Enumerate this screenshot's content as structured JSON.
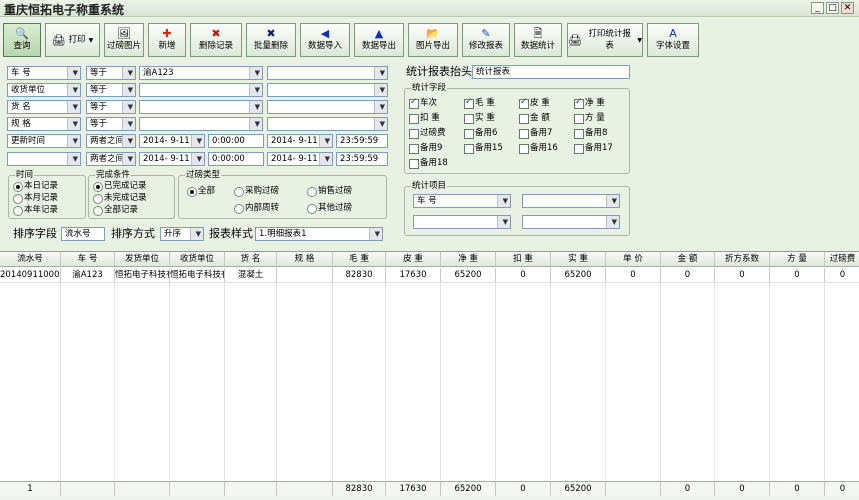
{
  "window": {
    "title": "重庆恒拓电子称重系统",
    "min": "_",
    "max": "□",
    "close": "✕"
  },
  "toolbar": [
    {
      "name": "query-button",
      "label": "查询",
      "icon": "🔍",
      "row": false,
      "sel": true
    },
    {
      "name": "print-button",
      "label": "打印",
      "icon": "🖨",
      "row": true,
      "drop": "▼"
    },
    {
      "name": "weigh-image-button",
      "label": "过磅图片",
      "icon": "🖼"
    },
    {
      "name": "add-button",
      "label": "新增",
      "icon": "✚",
      "color": "#d21"
    },
    {
      "name": "delete-record-button",
      "label": "删除记录",
      "icon": "✖",
      "color": "#c11"
    },
    {
      "name": "batch-delete-button",
      "label": "批量删除",
      "icon": "✖",
      "color": "#126"
    },
    {
      "name": "data-import-button",
      "label": "数据导入",
      "icon": "◀",
      "color": "#13a"
    },
    {
      "name": "data-export-button",
      "label": "数据导出",
      "icon": "▲",
      "color": "#13a"
    },
    {
      "name": "image-export-button",
      "label": "图片导出",
      "icon": "📂"
    },
    {
      "name": "edit-report-button",
      "label": "修改报表",
      "icon": "✎",
      "color": "#24a"
    },
    {
      "name": "data-stats-button",
      "label": "数据统计",
      "icon": "🗎"
    },
    {
      "name": "print-stats-report-button",
      "label": "打印统计报表",
      "icon": "🖨",
      "row": true,
      "drop": "▼"
    },
    {
      "name": "font-settings-button",
      "label": "字体设置",
      "icon": "A",
      "color": "#13a"
    }
  ],
  "filters": [
    {
      "field": "车 号",
      "op": "等于",
      "value": "渝A123",
      "value2": ""
    },
    {
      "field": "收货单位",
      "op": "等于",
      "value": "",
      "value2": ""
    },
    {
      "field": "货 名",
      "op": "等于",
      "value": "",
      "value2": ""
    },
    {
      "field": "规 格",
      "op": "等于",
      "value": "",
      "value2": ""
    },
    {
      "field": "更新时间",
      "op": "两者之间",
      "date1": "2014- 9-11",
      "time1": "0:00:00",
      "date2": "2014- 9-11",
      "time2": "23:59:59"
    },
    {
      "field": "",
      "op": "两者之间",
      "date1": "2014- 9-11",
      "time1": "0:00:00",
      "date2": "2014- 9-11",
      "time2": "23:59:59"
    }
  ],
  "time_group": {
    "title": "时间",
    "options": [
      "本日记录",
      "本月记录",
      "本年记录"
    ],
    "selected": 0
  },
  "complete_group": {
    "title": "完成条件",
    "options": [
      "已完成记录",
      "未完成记录",
      "全部记录"
    ],
    "selected": 0
  },
  "weigh_type_group": {
    "title": "过磅类型",
    "options": [
      "全部",
      "采购过磅",
      "销售过磅",
      "内部周转",
      "其他过磅"
    ],
    "selected": 0
  },
  "sort": {
    "label": "排序字段",
    "field": "流水号",
    "mode_label": "排序方式",
    "mode": "升序",
    "style_label": "报表样式",
    "style": "1.明细报表1"
  },
  "report": {
    "header_label": "统计报表抬头",
    "header_value": "统计报表"
  },
  "stat_fields": {
    "title": "统计字段",
    "items": [
      {
        "label": "车次",
        "checked": true
      },
      {
        "label": "毛 重",
        "checked": true
      },
      {
        "label": "皮 重",
        "checked": true
      },
      {
        "label": "净 重",
        "checked": true
      },
      {
        "label": "扣 重",
        "checked": false
      },
      {
        "label": "实 重",
        "checked": false
      },
      {
        "label": "金 额",
        "checked": false
      },
      {
        "label": "方 量",
        "checked": false
      },
      {
        "label": "过磅费",
        "checked": false
      },
      {
        "label": "备用6",
        "checked": false
      },
      {
        "label": "备用7",
        "checked": false
      },
      {
        "label": "备用8",
        "checked": false
      },
      {
        "label": "备用9",
        "checked": false
      },
      {
        "label": "备用15",
        "checked": false
      },
      {
        "label": "备用16",
        "checked": false
      },
      {
        "label": "备用17",
        "checked": false
      },
      {
        "label": "备用18",
        "checked": false
      }
    ]
  },
  "stat_items": {
    "title": "统计项目",
    "fields": [
      "车 号",
      "",
      "",
      ""
    ]
  },
  "table": {
    "columns": [
      "流水号",
      "车 号",
      "发货单位",
      "收货单位",
      "货 名",
      "规 格",
      "毛 重",
      "皮 重",
      "净 重",
      "扣 重",
      "实 重",
      "单 价",
      "金 额",
      "折方系数",
      "方 量",
      "过磅费"
    ],
    "rows": [
      [
        "201409110001",
        "渝A123",
        "恒拓电子科技有限",
        "恒拓电子科技有限",
        "混凝土",
        "",
        "82830",
        "17630",
        "65200",
        "0",
        "65200",
        "0",
        "0",
        "0",
        "0",
        "0"
      ]
    ],
    "footer": [
      "1",
      "",
      "",
      "",
      "",
      "",
      "82830",
      "17630",
      "65200",
      "0",
      "65200",
      "",
      "0",
      "0",
      "0",
      "0"
    ]
  }
}
